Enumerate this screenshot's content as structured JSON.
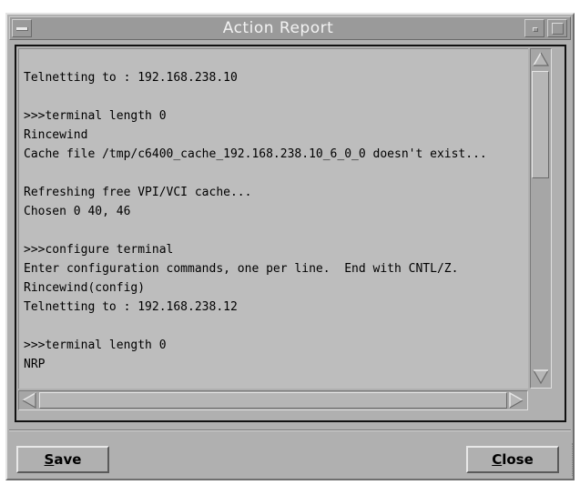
{
  "window": {
    "title": "Action Report"
  },
  "log": {
    "lines": [
      "",
      "Telnetting to : 192.168.238.10",
      "",
      ">>>terminal length 0",
      "Rincewind",
      "Cache file /tmp/c6400_cache_192.168.238.10_6_0_0 doesn't exist...",
      "",
      "Refreshing free VPI/VCI cache...",
      "Chosen 0 40, 46",
      "",
      ">>>configure terminal",
      "Enter configuration commands, one per line.  End with CNTL/Z.",
      "Rincewind(config)",
      "Telnetting to : 192.168.238.12",
      "",
      ">>>terminal length 0",
      "NRP"
    ]
  },
  "buttons": {
    "save": {
      "mnemonic": "S",
      "rest": "ave"
    },
    "close": {
      "mnemonic": "C",
      "rest": "lose"
    }
  },
  "icons": {
    "window_menu": "window-menu-icon",
    "minimize": "minimize-icon",
    "maximize": "maximize-icon",
    "scroll_up": "arrow-up-icon",
    "scroll_down": "arrow-down-icon",
    "scroll_left": "arrow-left-icon",
    "scroll_right": "arrow-right-icon"
  },
  "colors": {
    "window_bg": "#b0b0b0",
    "titlebar_bg": "#9a9a9a",
    "title_text": "#f2f2f2",
    "text_area_bg": "#bdbdbd"
  }
}
